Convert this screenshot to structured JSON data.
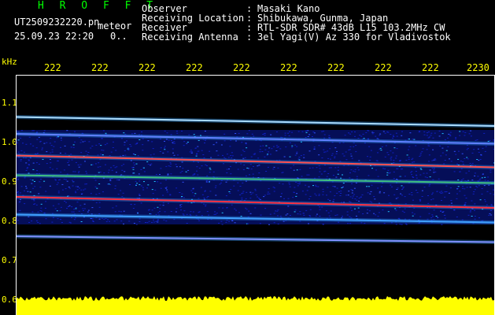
{
  "header": {
    "app_title": "H R O F F T",
    "file_name": "UT2509232220.pn",
    "meteor_label": "meteor",
    "datetime": "25.09.23 22:20",
    "count": "0..",
    "fields": [
      {
        "label": "Observer",
        "colon": ":",
        "value": "Masaki Kano"
      },
      {
        "label": "Receiving Location",
        "colon": ":",
        "value": "Shibukawa, Gunma, Japan"
      },
      {
        "label": "Receiver",
        "colon": ":",
        "value": "RTL-SDR SDR# 43dB L15 103.2MHz CW"
      },
      {
        "label": "Receiving Antenna",
        "colon": ":",
        "value": "3el Yagi(V) Az 330 for Vladivostok"
      }
    ]
  },
  "chart_data": {
    "type": "heatmap",
    "ylabel": "kHz",
    "y_ticks": [
      "1.1",
      "1.0",
      "0.9",
      "0.8",
      "0.7",
      "0.6"
    ],
    "x_ticks": [
      "222",
      "222",
      "222",
      "222",
      "222",
      "222",
      "222",
      "222",
      "222",
      "2230"
    ],
    "ylim": [
      0.6,
      1.1
    ],
    "traces": [
      {
        "y_start": 1.063,
        "y_end": 1.04,
        "color": "#aadcff"
      },
      {
        "y_start": 1.02,
        "y_end": 0.995,
        "color": "#6080ff"
      },
      {
        "y_start": 0.965,
        "y_end": 0.935,
        "color": "#ff5050"
      },
      {
        "y_start": 0.915,
        "y_end": 0.895,
        "color": "#40c080"
      },
      {
        "y_start": 0.86,
        "y_end": 0.832,
        "color": "#ff3040"
      },
      {
        "y_start": 0.815,
        "y_end": 0.795,
        "color": "#40a0ff"
      },
      {
        "y_start": 0.76,
        "y_end": 0.745,
        "color": "#8090ff"
      }
    ],
    "colors": {
      "background": "#000000",
      "noise_band": "#0a1aa0",
      "strip": "#ffff00"
    }
  }
}
